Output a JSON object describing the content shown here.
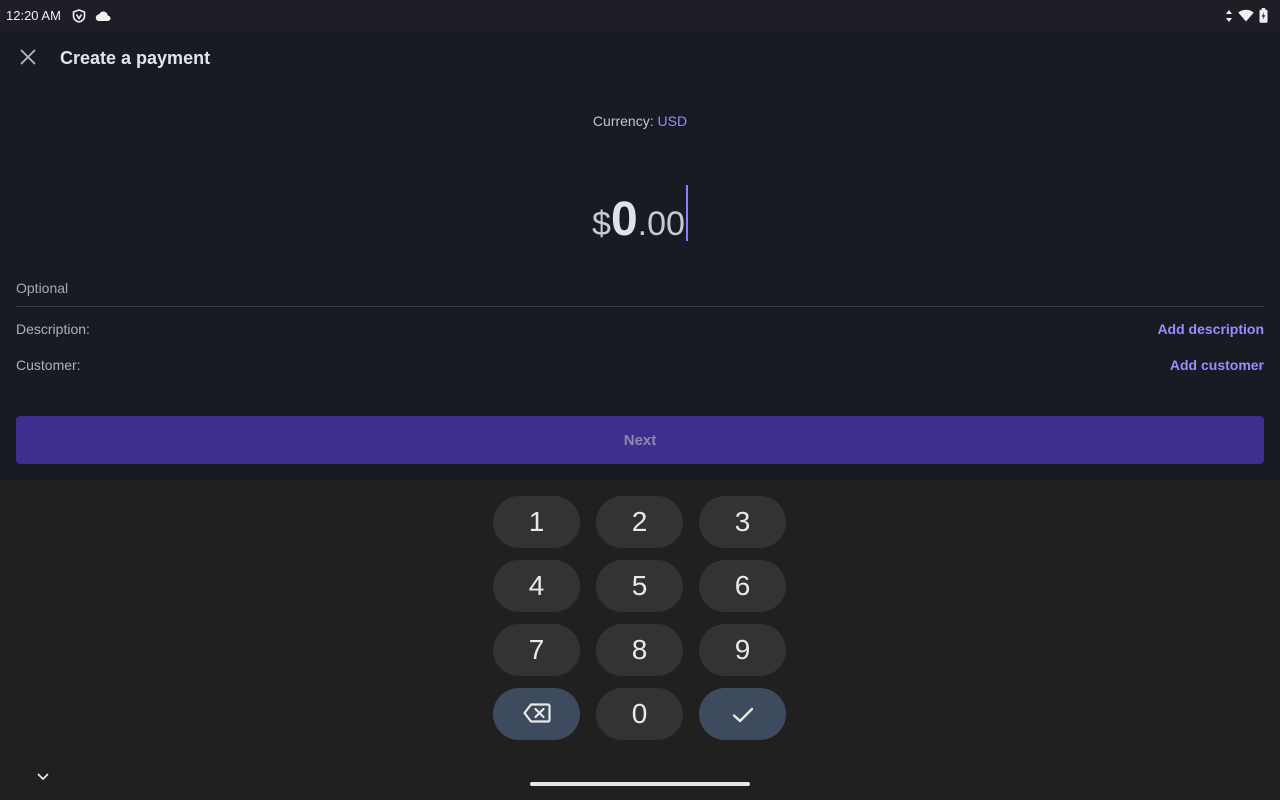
{
  "status_bar": {
    "time": "12:20 AM",
    "left_icons": [
      "vpn-shield-icon",
      "cloud-icon"
    ],
    "right_icons": [
      "data-arrows-icon",
      "wifi-icon",
      "battery-icon"
    ]
  },
  "header": {
    "title": "Create a payment",
    "close_icon": "close-icon"
  },
  "currency": {
    "label": "Currency:",
    "code": "USD"
  },
  "amount": {
    "symbol": "$",
    "whole": "0",
    "decimal": ".00"
  },
  "optional": {
    "section_label": "Optional",
    "description_label": "Description:",
    "description_action": "Add description",
    "customer_label": "Customer:",
    "customer_action": "Add customer"
  },
  "next_button": {
    "label": "Next"
  },
  "keypad": {
    "keys": [
      "1",
      "2",
      "3",
      "4",
      "5",
      "6",
      "7",
      "8",
      "9",
      "0"
    ],
    "backspace_icon": "backspace-icon",
    "confirm_icon": "check-icon",
    "collapse_icon": "chevron-down-icon"
  },
  "colors": {
    "accent": "#9b8cff",
    "button_bg": "#3c2f90",
    "background": "#181a24",
    "keyboard_bg": "#202020"
  }
}
